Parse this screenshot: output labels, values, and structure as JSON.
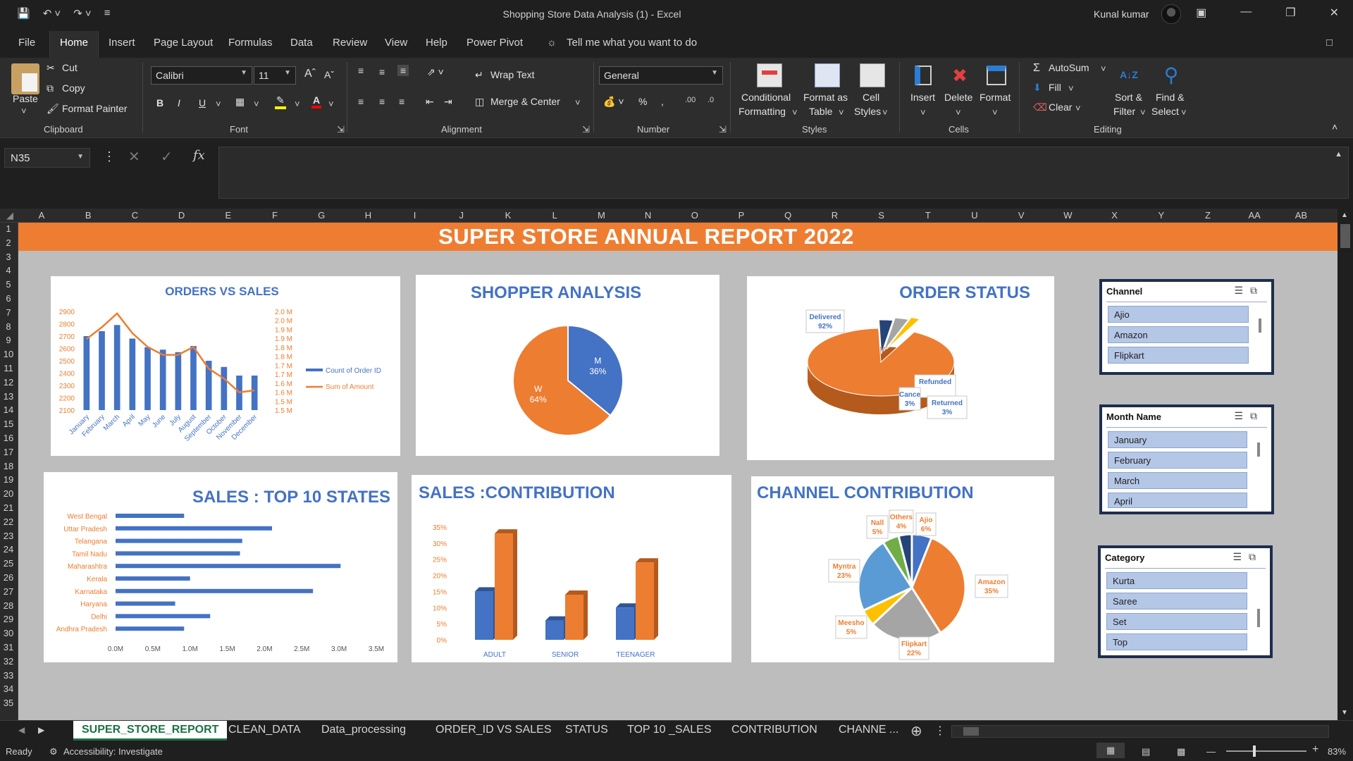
{
  "titlebar": {
    "doc_title": "Shopping Store Data Analysis (1)  -  Excel",
    "user": "Kunal kumar"
  },
  "menu": {
    "tabs": [
      "File",
      "Home",
      "Insert",
      "Page Layout",
      "Formulas",
      "Data",
      "Review",
      "View",
      "Help",
      "Power Pivot"
    ],
    "tell_me": "Tell me what you want to do"
  },
  "ribbon": {
    "clipboard": {
      "paste": "Paste",
      "cut": "Cut",
      "copy": "Copy",
      "format_painter": "Format Painter",
      "label": "Clipboard"
    },
    "font": {
      "name": "Calibri",
      "size": "11",
      "label": "Font"
    },
    "alignment": {
      "wrap": "Wrap Text",
      "merge": "Merge & Center",
      "label": "Alignment"
    },
    "number": {
      "format": "General",
      "label": "Number"
    },
    "styles": {
      "conditional": "Conditional",
      "conditional2": "Formatting",
      "format_as": "Format as",
      "format_as2": "Table",
      "cell": "Cell",
      "cell2": "Styles",
      "label": "Styles"
    },
    "cells": {
      "insert": "Insert",
      "delete": "Delete",
      "format": "Format",
      "label": "Cells"
    },
    "editing": {
      "autosum": "AutoSum",
      "fill": "Fill",
      "clear": "Clear",
      "sort": "Sort &",
      "sort2": "Filter",
      "find": "Find &",
      "find2": "Select",
      "label": "Editing"
    }
  },
  "formula": {
    "namebox": "N35",
    "fx": "fx"
  },
  "columns": [
    "A",
    "B",
    "C",
    "D",
    "E",
    "F",
    "G",
    "H",
    "I",
    "J",
    "K",
    "L",
    "M",
    "N",
    "O",
    "P",
    "Q",
    "R",
    "S",
    "T",
    "U",
    "V",
    "W",
    "X",
    "Y",
    "Z",
    "AA",
    "AB"
  ],
  "rows": [
    "1",
    "2",
    "3",
    "4",
    "5",
    "6",
    "7",
    "8",
    "9",
    "10",
    "11",
    "12",
    "13",
    "14",
    "15",
    "16",
    "17",
    "18",
    "19",
    "20",
    "21",
    "22",
    "23",
    "24",
    "25",
    "26",
    "27",
    "28",
    "29",
    "30",
    "31",
    "32",
    "33",
    "34",
    "35"
  ],
  "banner": "SUPER STORE ANNUAL REPORT 2022",
  "chart_data": [
    {
      "type": "bar",
      "title": "ORDERS VS SALES",
      "categories": [
        "January",
        "February",
        "March",
        "April",
        "May",
        "June",
        "July",
        "August",
        "September",
        "October",
        "November",
        "December"
      ],
      "series": [
        {
          "name": "Count of Order ID",
          "type": "bar",
          "color": "#4472c4",
          "values": [
            2700,
            2740,
            2790,
            2680,
            2610,
            2590,
            2570,
            2620,
            2500,
            2450,
            2380,
            2380
          ]
        },
        {
          "name": "Sum of Amount",
          "type": "line",
          "color": "#ed7d31",
          "values": [
            1.86,
            1.92,
            1.99,
            1.89,
            1.82,
            1.78,
            1.78,
            1.82,
            1.71,
            1.66,
            1.59,
            1.6
          ]
        }
      ],
      "y_ticks": [
        "2900",
        "2800",
        "2700",
        "2600",
        "2500",
        "2400",
        "2300",
        "2200",
        "2100"
      ],
      "y2_ticks": [
        "2.0 M",
        "2.0 M",
        "1.9 M",
        "1.9 M",
        "1.8 M",
        "1.8 M",
        "1.7 M",
        "1.7 M",
        "1.6 M",
        "1.6 M",
        "1.5 M",
        "1.5 M"
      ],
      "ylim": [
        2100,
        2900
      ],
      "y2lim": [
        1.5,
        2.0
      ],
      "legend": "right"
    },
    {
      "type": "pie",
      "title": "SHOPPER ANALYSIS",
      "slices": [
        {
          "label": "M",
          "value": 36,
          "text": "36%",
          "color": "#4472c4"
        },
        {
          "label": "W",
          "value": 64,
          "text": "64%",
          "color": "#ed7d31"
        }
      ]
    },
    {
      "type": "pie",
      "title": "ORDER STATUS",
      "slices": [
        {
          "label": "Delivered",
          "value": 92,
          "text": "92%",
          "color": "#ed7d31"
        },
        {
          "label": "Cancelled",
          "label_shown": "Cance",
          "value": 3,
          "text": "3%",
          "color": "#264478"
        },
        {
          "label": "Returned",
          "value": 3,
          "text": "3%",
          "color": "#a5a5a5"
        },
        {
          "label": "Refunded",
          "value": 2,
          "text": "",
          "color": "#ffc000"
        }
      ]
    },
    {
      "type": "bar",
      "orientation": "horizontal",
      "title": "SALES : TOP 10 STATES",
      "categories": [
        "West Bengal",
        "Uttar Pradesh",
        "Telangana",
        "Tamil Nadu",
        "Maharashtra",
        "Kerala",
        "Karnataka",
        "Haryana",
        "Delhi",
        "Andhra Pradesh"
      ],
      "values": [
        0.92,
        2.1,
        1.7,
        1.67,
        3.02,
        1.0,
        2.65,
        0.8,
        1.27,
        0.92
      ],
      "x_ticks": [
        "0.0M",
        "0.5M",
        "1.0M",
        "1.5M",
        "2.0M",
        "2.5M",
        "3.0M",
        "3.5M"
      ],
      "xlim": [
        0,
        3.5
      ]
    },
    {
      "type": "bar",
      "title": "SALES :CONTRIBUTION",
      "categories": [
        "ADULT",
        "SENIOR",
        "TEENAGER"
      ],
      "series": [
        {
          "color": "#4472c4",
          "values": [
            15,
            6,
            10
          ]
        },
        {
          "color": "#ed7d31",
          "values": [
            33,
            14,
            24
          ]
        }
      ],
      "y_ticks": [
        "35%",
        "30%",
        "25%",
        "20%",
        "15%",
        "10%",
        "5%",
        "0%"
      ],
      "ylim": [
        0,
        35
      ]
    },
    {
      "type": "pie",
      "title": "CHANNEL CONTRIBUTION",
      "slices": [
        {
          "label": "Ajio",
          "value": 6,
          "text": "6%",
          "color": "#4472c4"
        },
        {
          "label": "Amazon",
          "value": 35,
          "text": "35%",
          "color": "#ed7d31"
        },
        {
          "label": "Flipkart",
          "value": 22,
          "text": "22%",
          "color": "#a5a5a5"
        },
        {
          "label": "Meesho",
          "value": 5,
          "text": "5%",
          "color": "#ffc000"
        },
        {
          "label": "Myntra",
          "value": 23,
          "text": "23%",
          "color": "#5b9bd5"
        },
        {
          "label": "Nalli",
          "label_shown": "Nall",
          "value": 5,
          "text": "5%",
          "color": "#70ad47"
        },
        {
          "label": "Others",
          "value": 4,
          "text": "4%",
          "color": "#264478"
        }
      ]
    }
  ],
  "slicers": [
    {
      "title": "Channel",
      "items": [
        "Ajio",
        "Amazon",
        "Flipkart"
      ]
    },
    {
      "title": "Month Name",
      "items": [
        "January",
        "February",
        "March",
        "April"
      ]
    },
    {
      "title": "Category",
      "items": [
        "Kurta",
        "Saree",
        "Set",
        "Top"
      ]
    }
  ],
  "sheet_tabs": [
    "SUPER_STORE_REPORT",
    "CLEAN_DATA",
    "Data_processing",
    "ORDER_ID VS SALES",
    "STATUS",
    "TOP 10 _SALES",
    "CONTRIBUTION",
    "CHANNE ..."
  ],
  "status": {
    "ready": "Ready",
    "accessibility": "Accessibility: Investigate",
    "zoom": "83%"
  }
}
